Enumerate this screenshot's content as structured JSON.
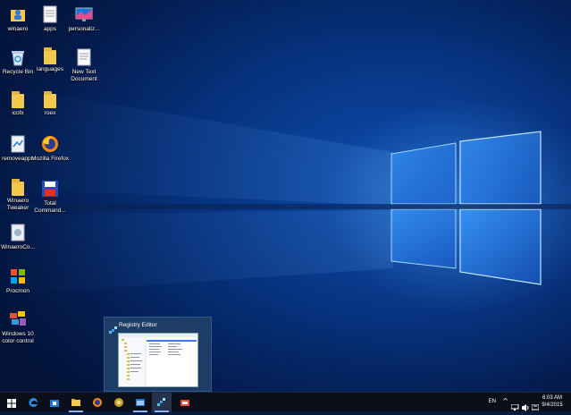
{
  "desktop": {
    "icons": [
      {
        "label": "winaero",
        "icon": "user-folder-icon"
      },
      {
        "label": "apps",
        "icon": "document-icon"
      },
      {
        "label": "personaliz...",
        "icon": "personalization-monitor-icon"
      },
      {
        "label": "Recycle Bin",
        "icon": "recycle-bin-icon"
      },
      {
        "label": "languages",
        "icon": "folder-icon"
      },
      {
        "label": "New Text Document",
        "icon": "text-document-icon"
      },
      {
        "label": "icofx",
        "icon": "folder-icon"
      },
      {
        "label": "roex",
        "icon": "folder-icon"
      },
      {
        "label": "removeapps",
        "icon": "script-file-icon"
      },
      {
        "label": "Mozilla Firefox",
        "icon": "firefox-icon"
      },
      {
        "label": "Winaero Tweaker",
        "icon": "folder-icon"
      },
      {
        "label": "Total Command...",
        "icon": "total-commander-icon"
      },
      {
        "label": "WinaeroCo...",
        "icon": "file-icon"
      },
      {
        "label": "Procmon",
        "icon": "procmon-icon"
      },
      {
        "label": "Windows 10 color control",
        "icon": "color-control-icon"
      }
    ]
  },
  "thumbnail": {
    "title": "Registry Editor"
  },
  "taskbar": {
    "buttons": [
      {
        "name": "start",
        "icon": "windows-start-icon"
      },
      {
        "name": "edge",
        "icon": "edge-icon"
      },
      {
        "name": "store",
        "icon": "store-icon"
      },
      {
        "name": "file-explorer",
        "icon": "folder-icon"
      },
      {
        "name": "firefox",
        "icon": "firefox-icon"
      },
      {
        "name": "chrome-like",
        "icon": "app-icon"
      },
      {
        "name": "window",
        "icon": "window-icon"
      },
      {
        "name": "registry-editor",
        "icon": "registry-editor-icon"
      },
      {
        "name": "app",
        "icon": "app-icon"
      }
    ],
    "tray": {
      "language": "EN",
      "time": "6:03 AM",
      "date": "9/4/2015"
    }
  },
  "colors": {
    "taskbar": "#0b0f1a",
    "accent": "#8ab4f8",
    "wallpaper_deep": "#041a4a",
    "wallpaper_glow": "#46a0ff"
  }
}
